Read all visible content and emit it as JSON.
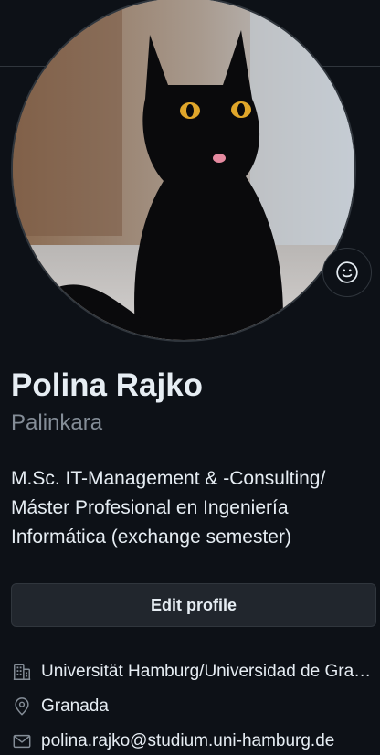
{
  "profile": {
    "avatar_alt": "Black cat avatar",
    "full_name": "Polina Rajko",
    "username": "Palinkara",
    "bio_lines": [
      "M.Sc. IT-Management & -Consulting/",
      "Máster Profesional en Ingeniería",
      "Informática (exchange semester)"
    ],
    "edit_button_label": "Edit profile",
    "status_icon": "smiley-icon"
  },
  "details": {
    "organization": "Universität Hamburg/Universidad de Granada",
    "location": "Granada",
    "email": "polina.rajko@studium.uni-hamburg.de"
  },
  "colors": {
    "background": "#0d1117",
    "text_primary": "#e6edf3",
    "text_secondary": "#848d97",
    "border": "#30363d",
    "button_bg": "#21262d"
  }
}
